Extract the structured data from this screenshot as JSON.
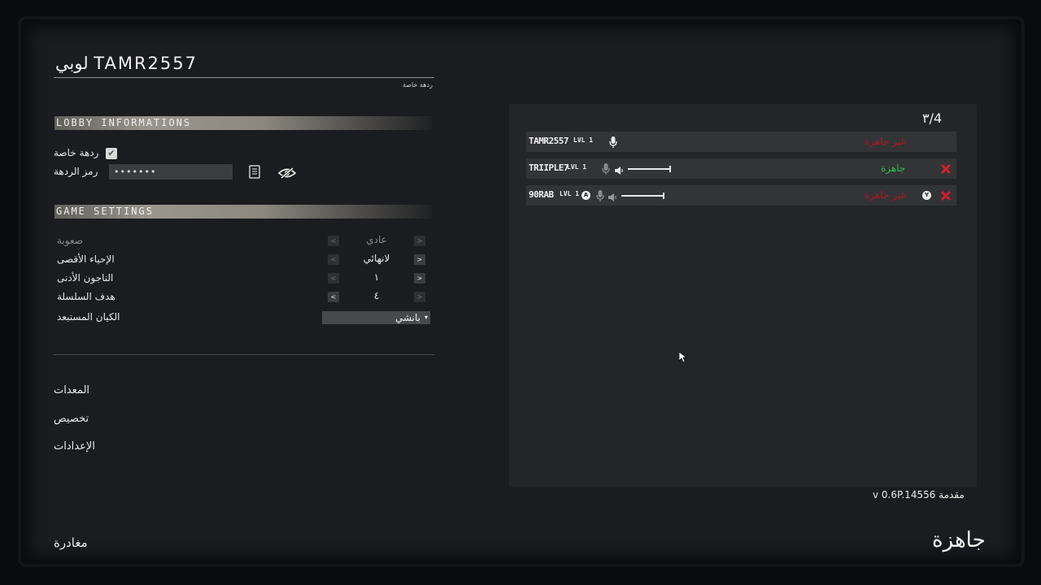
{
  "lobby": {
    "title": "لوبي TAMR2557",
    "subtitle": "ردهة خاصة"
  },
  "lobby_info": {
    "header": "LOBBY INFORMATIONS",
    "private_label": "ردهة خاصة",
    "private_checked": true,
    "password_label": "رمز الردهة",
    "password_value": "•••••••"
  },
  "game_settings": {
    "header": "GAME SETTINGS",
    "rows": [
      {
        "label": "صعوبة",
        "value": "عادي",
        "enabled": false
      },
      {
        "label": "الإحياء الأقصى",
        "value": "لانهائي",
        "enabled": true
      },
      {
        "label": "الناجون الأدنى",
        "value": "١",
        "enabled": true
      },
      {
        "label": "هدف السلسلة",
        "value": "٤",
        "enabled": true
      }
    ],
    "excluded_label": "الكيان المستبعد",
    "excluded_value": "بانشي"
  },
  "menu": {
    "equipment": "المعدات",
    "customize": "تخصيص",
    "settings": "الإعدادات",
    "leave": "مغادرة"
  },
  "players_panel": {
    "count": "٣/4",
    "players": [
      {
        "name": "TAMR2557",
        "level": "LVL 1",
        "status": "غير جاهزة",
        "status_color": "#b01428",
        "volume": null,
        "kickable": false,
        "button": null
      },
      {
        "name": "TRIIPLE7",
        "level": "LVL 1",
        "status": "جاهزة",
        "status_color": "#2fc24a",
        "volume": 1.0,
        "kickable": true,
        "button": null
      },
      {
        "name": "90RAB",
        "level": "LVL 1",
        "status": "غير جاهزة",
        "status_color": "#b01428",
        "volume": 1.0,
        "kickable": true,
        "button": "Y",
        "pre_button": "A"
      }
    ]
  },
  "version": "v 0.6P.14556 مقدمة",
  "ready_button": "جاهزة",
  "colors": {
    "ready_green": "#2fc24a",
    "not_ready_red": "#b01428",
    "kick_red": "#d0202a"
  }
}
